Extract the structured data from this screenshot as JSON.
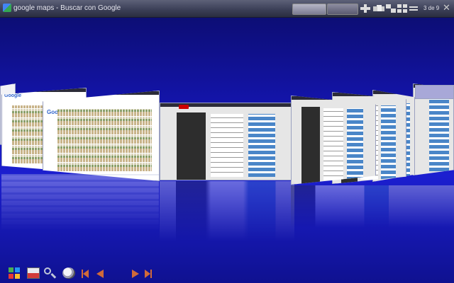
{
  "window": {
    "title": "google maps - Buscar con Google",
    "close_symbol": "✕",
    "close_icon": "close-icon"
  },
  "toolbar": {
    "mode_buttons": [
      "",
      ""
    ],
    "view_icons": [
      "view-cover-icon",
      "view-carousel-icon",
      "view-stack-icon",
      "view-grid-icon",
      "view-list-icon"
    ],
    "page_counter": "3 de 9"
  },
  "thumbnails": [
    {
      "kind": "blank",
      "name": "tab-blank"
    },
    {
      "kind": "google-maps",
      "name": "tab-google-maps-results-1",
      "logo": "Google"
    },
    {
      "kind": "google-maps",
      "name": "tab-google-maps-results-2",
      "logo": "Google"
    },
    {
      "kind": "youtube",
      "name": "tab-youtube-current"
    },
    {
      "kind": "youtube",
      "name": "tab-youtube-2"
    },
    {
      "kind": "youtube",
      "name": "tab-youtube-3"
    },
    {
      "kind": "youtube",
      "name": "tab-youtube-4"
    },
    {
      "kind": "youtube",
      "name": "tab-youtube-5"
    },
    {
      "kind": "blank",
      "name": "tab-blank-right"
    }
  ],
  "bottom_toolbar": {
    "icons": [
      "picasa-icon",
      "flag-icon",
      "zoom-icon",
      "save-icon"
    ],
    "nav": [
      "first-arrow-icon",
      "prev-arrow-icon",
      "next-arrow-icon",
      "last-arrow-icon"
    ],
    "accent_color": "#d06a3a"
  },
  "colors": {
    "background_top": "#0b0c6a",
    "background_mid": "#1c1fd0",
    "topbar": "#3c4058"
  }
}
